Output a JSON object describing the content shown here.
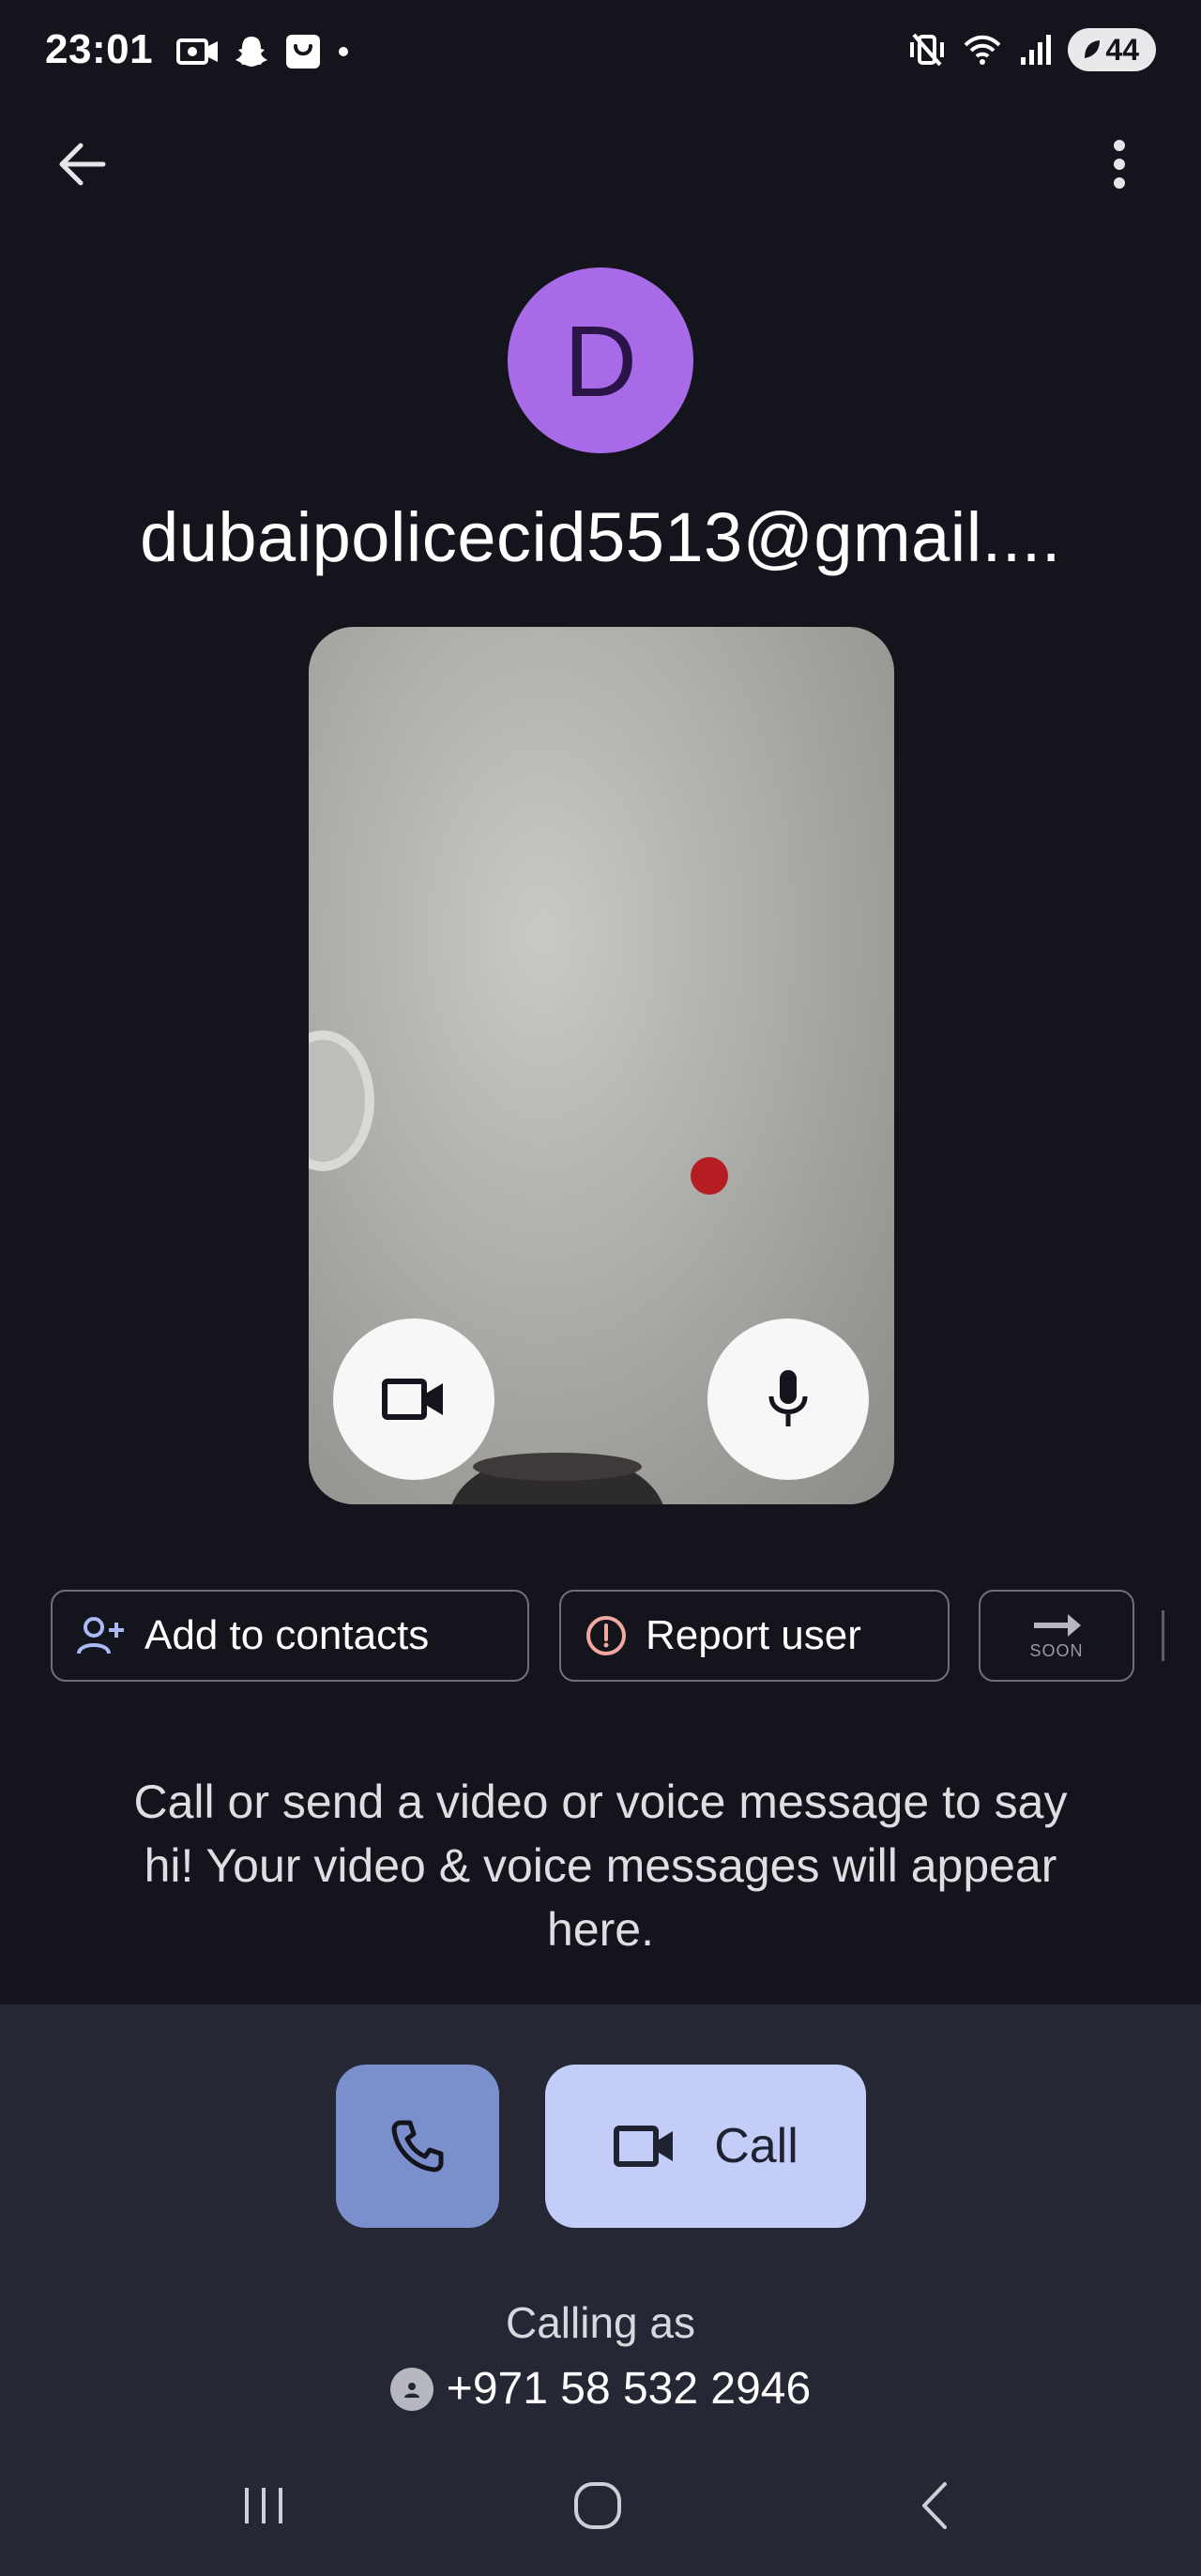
{
  "status_bar": {
    "time": "23:01",
    "battery": "44",
    "icons_left": [
      "video-recording-icon",
      "snapchat-icon",
      "shopping-bag-icon",
      "notification-dot-icon"
    ],
    "icons_right": [
      "vibrate-mute-icon",
      "wifi-icon",
      "signal-icon",
      "battery-icon"
    ]
  },
  "top_bar": {
    "back_icon": "arrow-back-icon",
    "more_icon": "more-vert-icon"
  },
  "contact": {
    "initial": "D",
    "name": "dubaipolicecid5513@gmail....",
    "avatar_color": "#a86ae6"
  },
  "preview": {
    "camera_icon": "videocam-icon",
    "mic_icon": "mic-icon"
  },
  "chips": {
    "add_contacts": "Add to contacts",
    "report_user": "Report user",
    "soon": "SOON"
  },
  "hint": "Call or send a video or voice message to say hi! Your video & voice messages will appear here.",
  "call_panel": {
    "video_call_label": "Call",
    "calling_as_label": "Calling as",
    "calling_number": "+971 58 532 2946",
    "voice_button_color": "#7b8fcd",
    "video_button_color": "#c3cdf7"
  },
  "nav_bar": {
    "recents": "recents-icon",
    "home": "home-icon",
    "back": "nav-back-icon"
  }
}
